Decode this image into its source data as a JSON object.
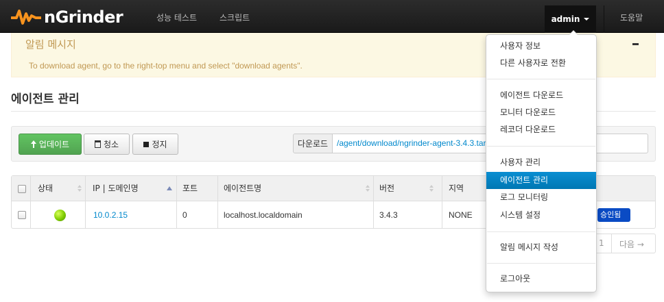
{
  "topbar": {
    "brand": "nGrinder",
    "nav": [
      "성능 테스트",
      "스크립트"
    ],
    "user": "admin",
    "help": "도움말"
  },
  "alert": {
    "title": "알림 메시지",
    "text": "To download agent, go to the right-top menu and select \"download agents\"."
  },
  "page": {
    "title": "에이전트 관리"
  },
  "toolbar": {
    "update_label": "업데이트",
    "clean_label": "청소",
    "stop_label": "정지",
    "download_label": "다운로드",
    "download_link": "/agent/download/ngrinder-agent-3.4.3.tar"
  },
  "table": {
    "headers": [
      "상태",
      "IP | 도메인명",
      "포트",
      "에이전트명",
      "버전",
      "지역"
    ],
    "rows": [
      {
        "status": "running",
        "ip": "10.0.2.15",
        "port": "0",
        "name": "localhost.localdomain",
        "version": "3.4.3",
        "region": "NONE",
        "approve": "승인됨"
      }
    ]
  },
  "pager": {
    "page": "1",
    "next": "다음 →"
  },
  "dropdown": {
    "items": [
      "사용자 정보",
      "다른 사용자로 전환",
      "에이전트 다운로드",
      "모니터 다운로드",
      "레코더 다운로드",
      "사용자 관리",
      "에이전트 관리",
      "로그 모니터링",
      "시스템 설정",
      "알림 메시지 작성",
      "로그아웃"
    ],
    "active_index": 6
  },
  "colors": {
    "brand_orange": "#f7931e",
    "active_blue": "#0a8ed2",
    "success_green": "#51a351",
    "alert_text": "#c09853"
  }
}
